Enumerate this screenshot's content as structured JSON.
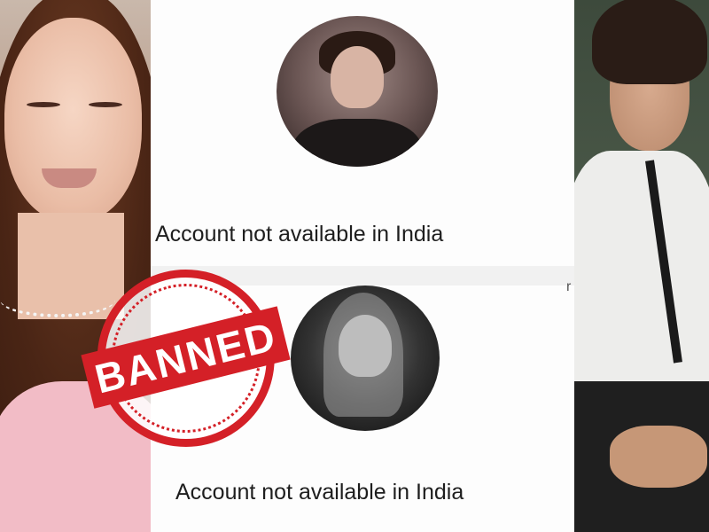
{
  "screenshot": {
    "profiles": [
      {
        "message": "Account not available in India"
      },
      {
        "message": "Account not available in India"
      }
    ],
    "edge_letter": "r"
  },
  "stamp": {
    "text": "BANNED",
    "color": "#d42027"
  },
  "icons": [
    "profile-avatar-icon",
    "banned-stamp-icon"
  ]
}
